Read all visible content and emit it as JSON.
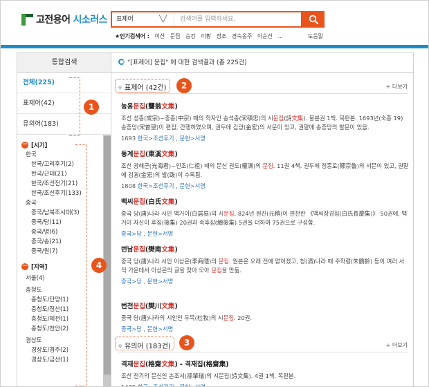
{
  "header": {
    "logo_text": "고전용어",
    "logo_sub": "시소러스",
    "search_select": "표제어",
    "search_placeholder": "검색어를 입력하세요.",
    "popular_label": "★인기검색어 :",
    "popular": [
      "이산",
      "문집",
      "승강",
      "이황",
      "정조",
      "경숙옹주",
      "이순신",
      "..."
    ],
    "help": "도움말"
  },
  "sidebar": {
    "title": "통합검색",
    "tabs": [
      {
        "label": "전체(225)",
        "active": true
      },
      {
        "label": "표제어(42)",
        "active": false
      },
      {
        "label": "유의어(183)",
        "active": false
      }
    ],
    "facets": [
      {
        "title": "[시기]",
        "groups": [
          {
            "name": "한국",
            "items": [
              "한국/고려후기(2)",
              "한국/근대(21)",
              "한국/조선전기(21)",
              "한국/조선후기(133)"
            ]
          },
          {
            "name": "중국",
            "items": [
              "중국/남북조시대(3)",
              "중국/당(11)",
              "중국/명(6)",
              "중국/송(21)",
              "중국/원(7)"
            ]
          }
        ]
      },
      {
        "title": "[지역]",
        "groups": [
          {
            "name": "서울(4)",
            "items": []
          },
          {
            "name": "충청도",
            "items": [
              "충청도/단양(1)",
              "충청도/정산(1)",
              "충청도/제천(1)",
              "충청도/천안(2)"
            ]
          },
          {
            "name": "경상도",
            "items": [
              "경상도/경주(2)",
              "경상도/금산(1)"
            ]
          }
        ]
      }
    ]
  },
  "results": {
    "summary": "\"[표제어] 문집\" 에 대한 검색결과 (총 225건)",
    "more_label": "+ 더보기",
    "sections": [
      {
        "title": "표제어 (42건)",
        "entries": [
          {
            "title": [
              {
                "t": "농옹"
              },
              {
                "t": "문집",
                "hl": true
              },
              {
                "t": "(聾翁"
              },
              {
                "t": "文集",
                "hl": true
              },
              {
                "t": ")"
              }
            ],
            "desc": [
              {
                "t": "조선 성종(成宗)~중종(中宗) 때의 학자인 송석충(宋碩忠)의 시"
              },
              {
                "t": "문집",
                "hl": true
              },
              {
                "t": "(詩"
              },
              {
                "t": "文集",
                "hl": true
              },
              {
                "t": "). 불분권 1책. 목판본. 1693년(숙종 19) 송증망(宋曾望)이 편집, 간행하였으며, 권두에 김광(金宏)의 서문이 있고, 권말에 송증망의 발문이 있음."
              }
            ],
            "meta_prefix": "1693",
            "meta_links": [
              "한국>조선후기",
              "문헌>서명"
            ]
          },
          {
            "title": [
              {
                "t": "동계"
              },
              {
                "t": "문집",
                "hl": true
              },
              {
                "t": "(東溪"
              },
              {
                "t": "文集",
                "hl": true
              },
              {
                "t": ")"
              }
            ],
            "desc": [
              {
                "t": "조선 광해군(光海君)~인조(仁祖) 때의 문신 권도(權濤)의 "
              },
              {
                "t": "문집",
                "hl": true
              },
              {
                "t": ". 11권 4책. 권두에 정종로(鄭宗魯)의 서문이 있고, 권말에 김굉(金宏)의 발(跋)이 수록됨."
              }
            ],
            "meta_prefix": "1808",
            "meta_links": [
              "한국>조선후기",
              "문헌>서명"
            ]
          },
          {
            "title": [
              {
                "t": "백씨"
              },
              {
                "t": "문집",
                "hl": true
              },
              {
                "t": "(白氏"
              },
              {
                "t": "文集",
                "hl": true
              },
              {
                "t": ")"
              }
            ],
            "desc": [
              {
                "t": "중국 당(唐)나라 시인 백거이(白居易)의 시"
              },
              {
                "t": "문집",
                "hl": true
              },
              {
                "t": ". 824년 원진(元稹)이 편찬한 《백씨장경집(白氏長慶集)》 50권에, 백거이 자신이 후집(後集) 20권과 속후집(續後集) 5권을 더하여 75권으로 구성함."
              }
            ],
            "meta_prefix": "",
            "meta_links": [
              "중국>당",
              "문헌>서명"
            ]
          },
          {
            "title": [
              {
                "t": "번남"
              },
              {
                "t": "문집",
                "hl": true
              },
              {
                "t": "(樊南"
              },
              {
                "t": "文集",
                "hl": true
              },
              {
                "t": ")"
              }
            ],
            "desc": [
              {
                "t": "중국 당(唐)나라 시인 이상은(李商隱)의 "
              },
              {
                "t": "문집",
                "hl": true
              },
              {
                "t": ". 원본은 오래 전에 없어졌고, 청(淸)나라 때 주학령(朱鶴齡) 등이 여러 서적 가운데서 이상은의 글을 찾아 모아 "
              },
              {
                "t": "문집",
                "hl": true
              },
              {
                "t": "을 만듦."
              }
            ],
            "meta_prefix": "",
            "meta_links": [
              "중국>당",
              "문헌>서명"
            ]
          },
          {
            "title": [
              {
                "t": "번천"
              },
              {
                "t": "문집",
                "hl": true
              },
              {
                "t": "(樊川"
              },
              {
                "t": "文集",
                "hl": true
              },
              {
                "t": ")"
              }
            ],
            "desc": [
              {
                "t": "중국 당(唐)나라의 시인인 두목(杜牧)의 시"
              },
              {
                "t": "문집",
                "hl": true
              },
              {
                "t": ". 20권."
              }
            ],
            "meta_prefix": "",
            "meta_links": [
              "중국>당",
              "문헌>서명"
            ]
          }
        ]
      },
      {
        "title": "유의어 (183건)",
        "entries": [
          {
            "title": [
              {
                "t": "격재"
              },
              {
                "t": "문집",
                "hl": true
              },
              {
                "t": "(格齋"
              },
              {
                "t": "文集",
                "hl": true
              },
              {
                "t": ")  - 격재집(格齋集)"
              }
            ],
            "desc": [
              {
                "t": "조선 전기의 문신인 손조서(孫肇瑞)의 시문집(詩文集). 4권 1책. 목판본."
              }
            ],
            "meta_prefix": "1479",
            "meta_links": [
              "한국>조선전기",
              "문헌>서명"
            ]
          }
        ]
      }
    ]
  },
  "annotations": [
    "1",
    "2",
    "3",
    "4"
  ],
  "colors": {
    "accent": "#e8541c",
    "brand_blue": "#1f8cc6",
    "highlight": "#d8302a"
  }
}
